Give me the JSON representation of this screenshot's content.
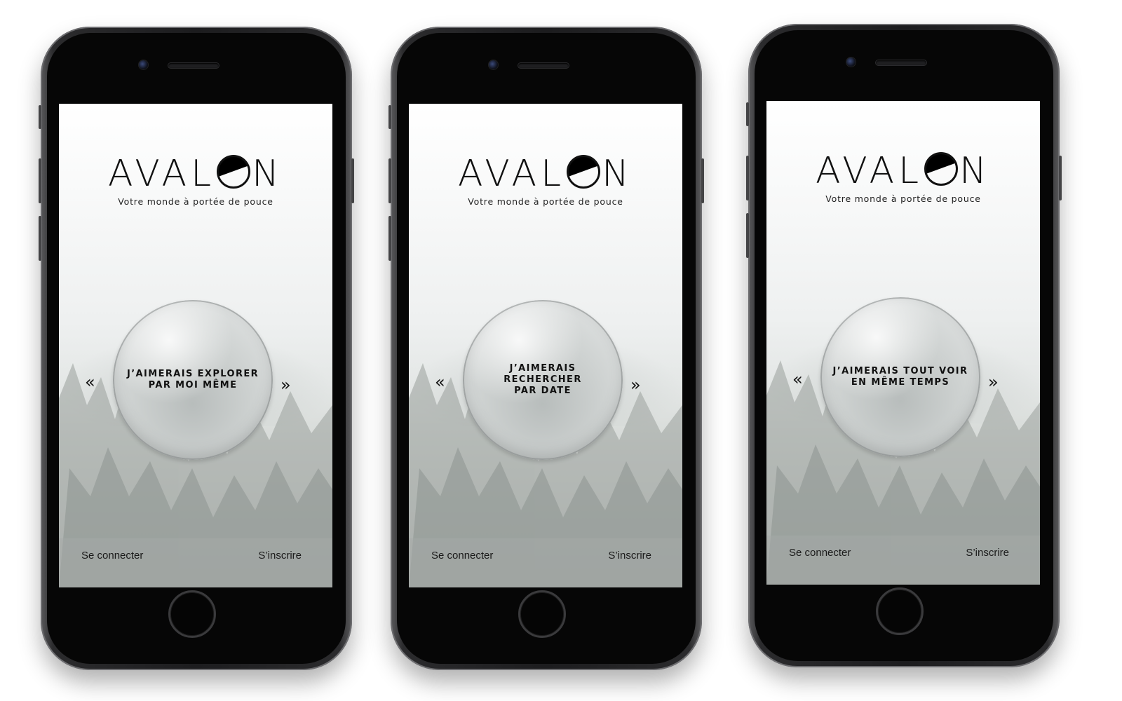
{
  "phones": [
    {
      "logo": "AVAL",
      "logo_end": "N",
      "tagline": "Votre monde à portée de pouce",
      "card_text": "J’AIMERAIS EXPLORER\nPAR MOI MÊME",
      "prev": "«",
      "next": "»",
      "login": "Se connecter",
      "signup": "S’inscrire"
    },
    {
      "logo": "AVAL",
      "logo_end": "N",
      "tagline": "Votre monde à portée de pouce",
      "card_text": "J’AIMERAIS RECHERCHER\nPAR DATE",
      "prev": "«",
      "next": "»",
      "login": "Se connecter",
      "signup": "S’inscrire"
    },
    {
      "logo": "AVAL",
      "logo_end": "N",
      "tagline": "Votre monde à portée de pouce",
      "card_text": "J’AIMERAIS TOUT VOIR\nEN MÊME TEMPS",
      "prev": "«",
      "next": "»",
      "login": "Se connecter",
      "signup": "S’inscrire"
    }
  ],
  "icons": {
    "prev": "double-chevron-left-icon",
    "next": "double-chevron-right-icon"
  },
  "colors": {
    "phone_body": "#1c1c1e",
    "text": "#111111",
    "screen_top": "#ffffff",
    "forest": "#9aa09c"
  }
}
